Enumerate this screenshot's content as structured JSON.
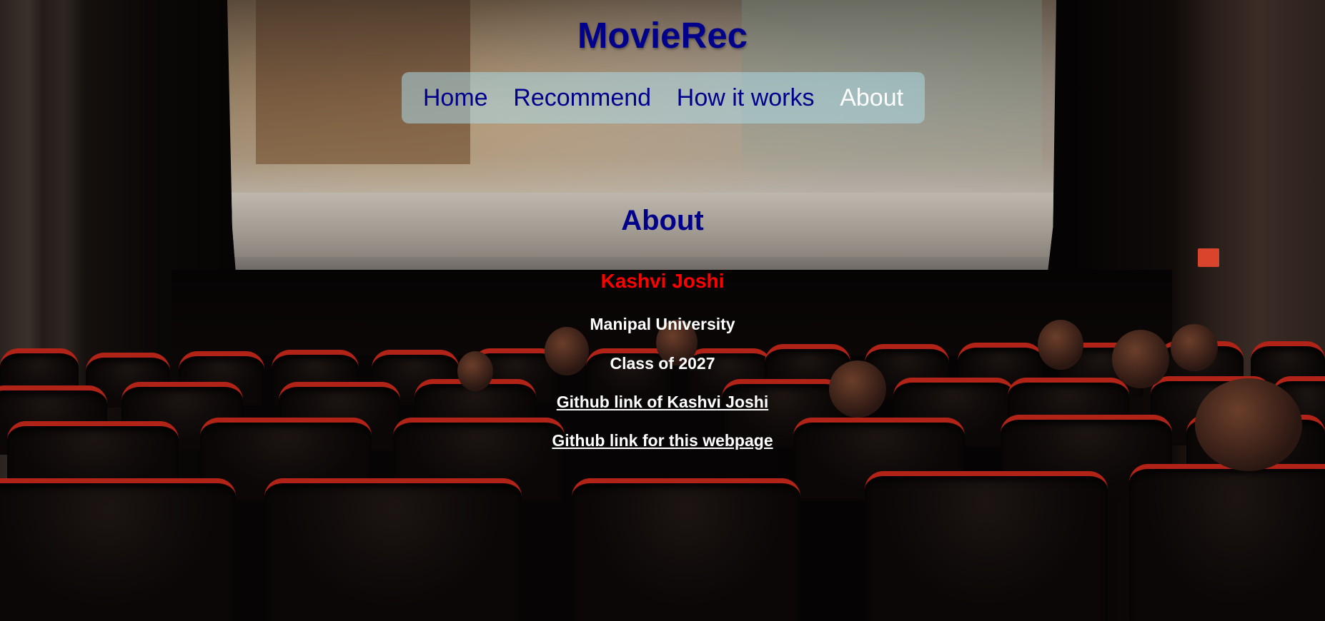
{
  "brand": "MovieRec",
  "nav": {
    "items": [
      {
        "label": "Home"
      },
      {
        "label": "Recommend"
      },
      {
        "label": "How it works"
      },
      {
        "label": "About"
      }
    ],
    "active": "About"
  },
  "about": {
    "title": "About",
    "name": "Kashvi Joshi",
    "university": "Manipal University",
    "class_year": "Class of 2027",
    "github_profile_label": "Github link of Kashvi Joshi",
    "github_repo_label": "Github link for this webpage"
  },
  "colors": {
    "brand": "#00008b",
    "nav_background": "#add8e6",
    "nav_active": "#ffffff",
    "name": "#ff0000",
    "text": "#ffffff",
    "seat_red": "#b22317"
  },
  "background": {
    "description_icon": "cinema-theatre-image"
  }
}
